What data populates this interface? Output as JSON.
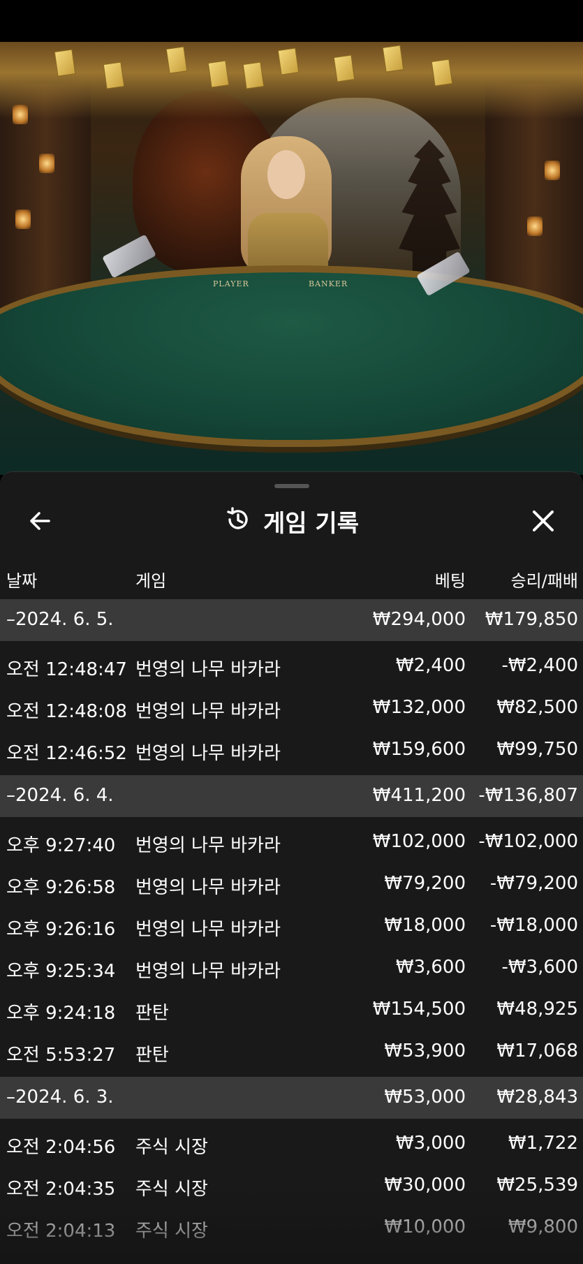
{
  "sheet": {
    "title": "게임 기록",
    "icons": {
      "back": "arrow-left-icon",
      "history": "history-clock-icon",
      "close": "close-icon"
    }
  },
  "columns": {
    "date": "날짜",
    "game": "게임",
    "bet": "베팅",
    "win_loss": "승리/패배"
  },
  "scene": {
    "player_label": "PLAYER",
    "banker_label": "BANKER"
  },
  "groups": [
    {
      "date": "–2024. 6. 5.",
      "bet_total": "₩294,000",
      "win_total": "₩179,850",
      "entries": [
        {
          "time": "오전 12:48:47",
          "game": "번영의 나무 바카라",
          "bet": "₩2,400",
          "win": "-₩2,400"
        },
        {
          "time": "오전 12:48:08",
          "game": "번영의 나무 바카라",
          "bet": "₩132,000",
          "win": "₩82,500"
        },
        {
          "time": "오전 12:46:52",
          "game": "번영의 나무 바카라",
          "bet": "₩159,600",
          "win": "₩99,750"
        }
      ]
    },
    {
      "date": "–2024. 6. 4.",
      "bet_total": "₩411,200",
      "win_total": "-₩136,807",
      "entries": [
        {
          "time": "오후 9:27:40",
          "game": "번영의 나무 바카라",
          "bet": "₩102,000",
          "win": "-₩102,000"
        },
        {
          "time": "오후 9:26:58",
          "game": "번영의 나무 바카라",
          "bet": "₩79,200",
          "win": "-₩79,200"
        },
        {
          "time": "오후 9:26:16",
          "game": "번영의 나무 바카라",
          "bet": "₩18,000",
          "win": "-₩18,000"
        },
        {
          "time": "오후 9:25:34",
          "game": "번영의 나무 바카라",
          "bet": "₩3,600",
          "win": "-₩3,600"
        },
        {
          "time": "오후 9:24:18",
          "game": "판탄",
          "bet": "₩154,500",
          "win": "₩48,925"
        },
        {
          "time": "오전 5:53:27",
          "game": "판탄",
          "bet": "₩53,900",
          "win": "₩17,068"
        }
      ]
    },
    {
      "date": "–2024. 6. 3.",
      "bet_total": "₩53,000",
      "win_total": "₩28,843",
      "entries": [
        {
          "time": "오전 2:04:56",
          "game": "주식 시장",
          "bet": "₩3,000",
          "win": "₩1,722"
        },
        {
          "time": "오전 2:04:35",
          "game": "주식 시장",
          "bet": "₩30,000",
          "win": "₩25,539"
        },
        {
          "time": "오전 2:04:13",
          "game": "주식 시장",
          "bet": "₩10,000",
          "win": "₩9,800"
        }
      ]
    }
  ]
}
